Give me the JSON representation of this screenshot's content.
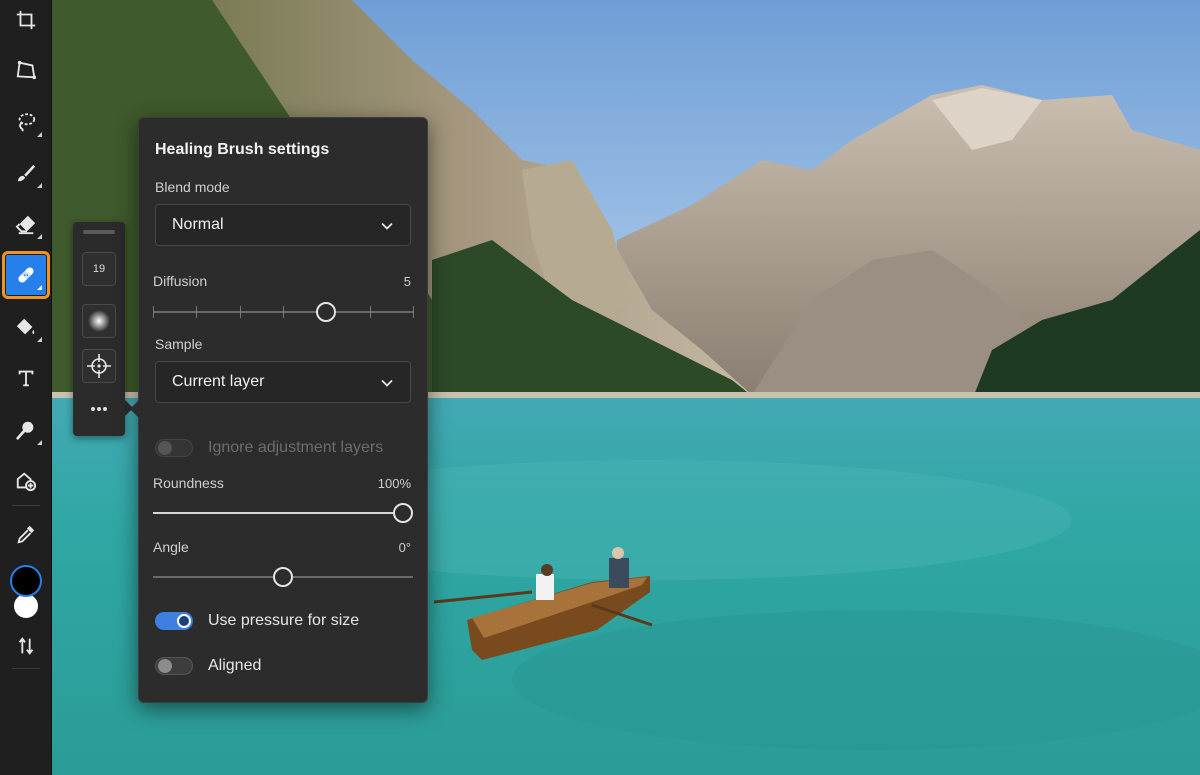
{
  "toolbar": {
    "tools": [
      {
        "name": "crop-icon"
      },
      {
        "name": "perspective-icon"
      },
      {
        "name": "lasso-icon"
      },
      {
        "name": "brush-icon"
      },
      {
        "name": "eraser-icon"
      },
      {
        "name": "healing-brush-icon"
      },
      {
        "name": "paint-bucket-icon"
      },
      {
        "name": "type-icon"
      },
      {
        "name": "magnifier-icon"
      },
      {
        "name": "place-image-icon"
      },
      {
        "name": "eyedropper-icon"
      }
    ],
    "foreground_color": "#000000",
    "background_color": "#ffffff",
    "accent_color": "#2680eb",
    "highlight_color": "#f29423"
  },
  "mini_panel": {
    "brush_size": "19",
    "more_icon": "ellipsis-icon"
  },
  "settings": {
    "title": "Healing Brush settings",
    "blend_mode": {
      "label": "Blend mode",
      "value": "Normal"
    },
    "diffusion": {
      "label": "Diffusion",
      "value": "5",
      "level": 5,
      "min": 1,
      "max": 7
    },
    "sample": {
      "label": "Sample",
      "value": "Current layer"
    },
    "ignore_adjustment": {
      "label": "Ignore adjustment layers",
      "enabled": false,
      "disabled": true
    },
    "roundness": {
      "label": "Roundness",
      "value": "100%",
      "percent": 100
    },
    "angle": {
      "label": "Angle",
      "value": "0°",
      "degrees": 0
    },
    "use_pressure": {
      "label": "Use pressure for size",
      "enabled": true
    },
    "aligned": {
      "label": "Aligned",
      "enabled": false
    }
  }
}
